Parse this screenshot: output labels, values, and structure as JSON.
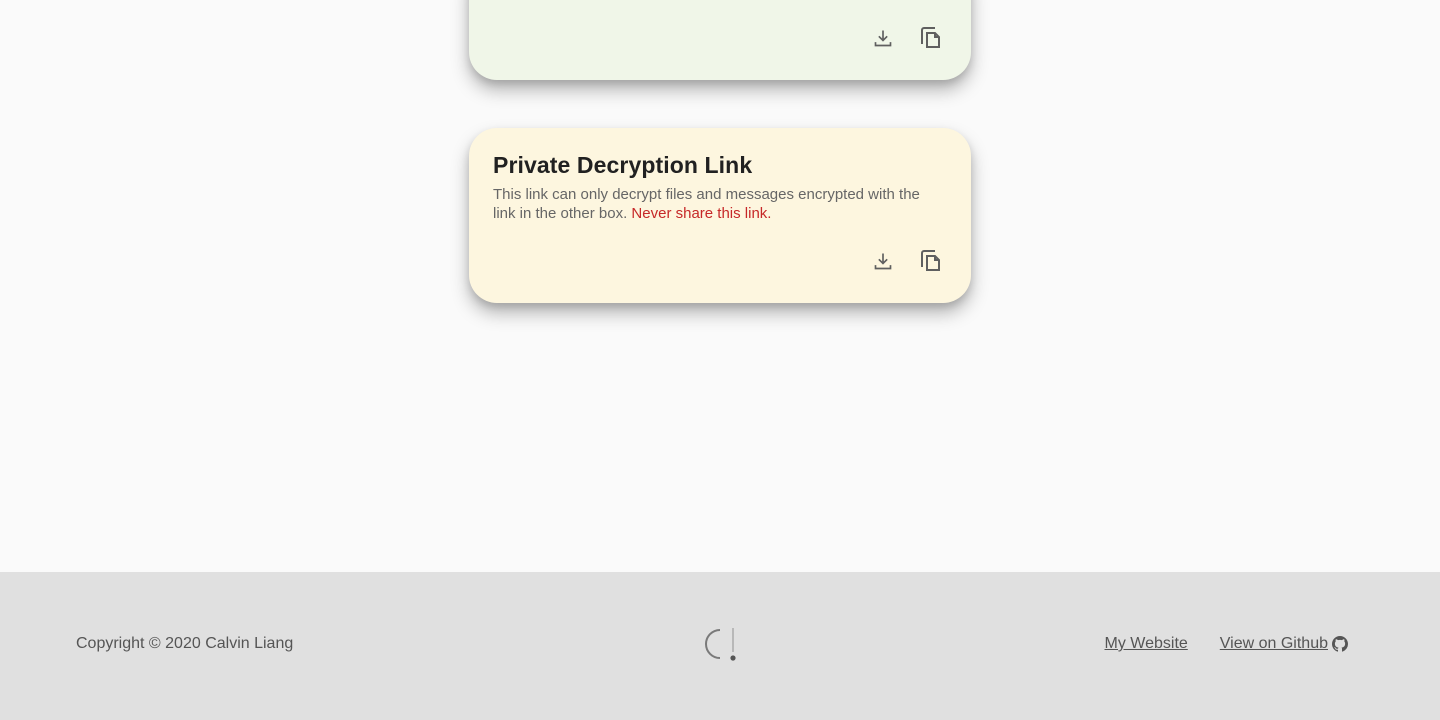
{
  "public_card": {
    "actions": [
      {
        "icon": "download-icon"
      },
      {
        "icon": "copy-icon"
      }
    ]
  },
  "private_card": {
    "title": "Private Decryption Link",
    "description": "This link can only decrypt files and messages encrypted with the link in the other box.",
    "warning": "Never share this link.",
    "actions": [
      {
        "icon": "download-icon"
      },
      {
        "icon": "copy-icon"
      }
    ]
  },
  "footer": {
    "copyright": "Copyright © 2020 Calvin Liang",
    "logo": "C!",
    "links": {
      "website": "My Website",
      "github": "View on Github"
    }
  },
  "colors": {
    "public_card_bg": "#f0f6e8",
    "private_card_bg": "#fdf6df",
    "warning": "#c62828",
    "footer_bg": "#e0e0e0"
  }
}
